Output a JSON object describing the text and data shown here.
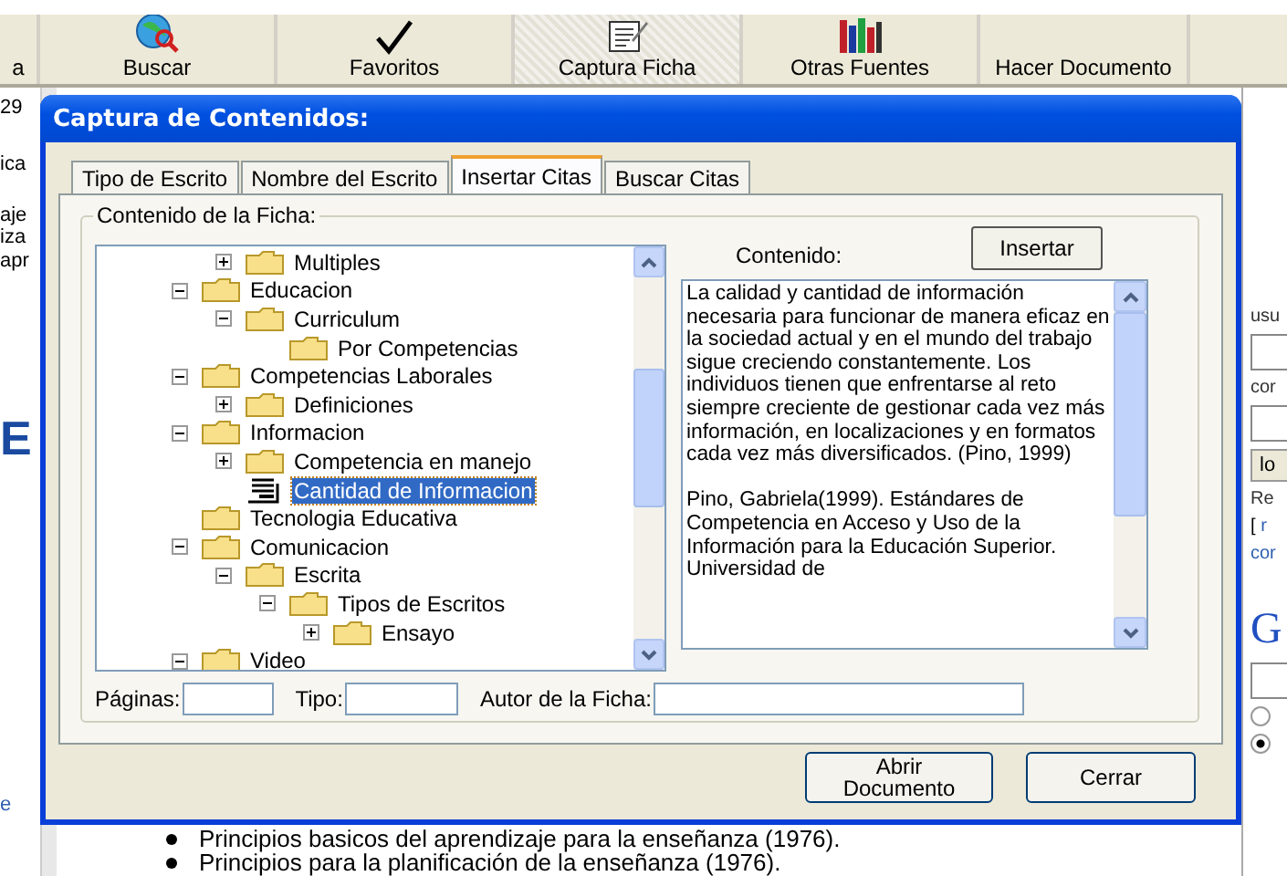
{
  "toolbar": [
    {
      "kind": "plain",
      "label": "a",
      "selected": false
    },
    {
      "kind": "search",
      "label": "Buscar",
      "selected": false
    },
    {
      "kind": "favorites",
      "label": "Favoritos",
      "selected": false
    },
    {
      "kind": "capture",
      "label": "Captura Ficha",
      "selected": true
    },
    {
      "kind": "sources",
      "label": "Otras Fuentes",
      "selected": false
    },
    {
      "kind": "plain",
      "label": "Hacer Documento",
      "selected": false
    }
  ],
  "left_fragments": [
    "29",
    "ica",
    "aje",
    "iza",
    "apr",
    "E",
    "e"
  ],
  "right_panel": [
    {
      "kind": "label",
      "text": "usu"
    },
    {
      "kind": "field"
    },
    {
      "kind": "label",
      "text": "cor"
    },
    {
      "kind": "field"
    },
    {
      "kind": "button",
      "text": "lo"
    },
    {
      "kind": "label",
      "text": "Re"
    },
    {
      "kind": "link",
      "prefix": "[",
      "text": "r"
    },
    {
      "kind": "link",
      "text": "cor"
    },
    {
      "kind": "heading",
      "text": "G"
    },
    {
      "kind": "field"
    },
    {
      "kind": "radio",
      "selected": false
    },
    {
      "kind": "radio",
      "selected": true
    }
  ],
  "bullets": [
    "Principios basicos del aprendizaje para la enseñanza (1976).",
    "Principios para la planificación de la enseñanza (1976)."
  ],
  "dialog": {
    "title": "Captura de Contenidos:",
    "tabs": [
      {
        "label": "Tipo de Escrito",
        "selected": false
      },
      {
        "label": "Nombre del Escrito",
        "selected": false
      },
      {
        "label": "Insertar Citas",
        "selected": true
      },
      {
        "label": "Buscar Citas",
        "selected": false
      }
    ],
    "group_label": "Contenido de la Ficha:",
    "tree": [
      {
        "children": [
          {
            "label": "Multiples",
            "kind": "folder",
            "expanded": false,
            "selected": false
          }
        ]
      },
      {
        "label": "Educacion",
        "kind": "folder",
        "expanded": true,
        "selected": false,
        "children": [
          {
            "label": "Curriculum",
            "kind": "folder",
            "expanded": true,
            "selected": false,
            "children": [
              {
                "label": "Por Competencias",
                "kind": "folder",
                "selected": false
              }
            ]
          }
        ]
      },
      {
        "label": "Competencias Laborales",
        "kind": "folder",
        "expanded": true,
        "selected": false,
        "children": [
          {
            "label": "Definiciones",
            "kind": "folder",
            "expanded": false,
            "selected": false
          }
        ]
      },
      {
        "label": "Informacion",
        "kind": "folder",
        "expanded": true,
        "selected": false,
        "children": [
          {
            "label": "Competencia en manejo",
            "kind": "folder",
            "expanded": false,
            "selected": false
          },
          {
            "label": "Cantidad de Informacion",
            "kind": "document",
            "selected": true
          }
        ]
      },
      {
        "label": "Tecnologia Educativa",
        "kind": "folder",
        "selected": false
      },
      {
        "label": "Comunicacion",
        "kind": "folder",
        "expanded": true,
        "selected": false,
        "children": [
          {
            "label": "Escrita",
            "kind": "folder",
            "expanded": true,
            "selected": false,
            "children": [
              {
                "label": "Tipos de Escritos",
                "kind": "folder",
                "expanded": true,
                "selected": false,
                "children": [
                  {
                    "label": "Ensayo",
                    "kind": "folder",
                    "expanded": false,
                    "selected": false
                  }
                ]
              }
            ]
          }
        ]
      },
      {
        "label": "Video",
        "kind": "folder",
        "expanded": true,
        "selected": false
      }
    ],
    "content_label": "Contenido:",
    "insert_button": "Insertar",
    "content_text": [
      "La calidad y cantidad de información necesaria para funcionar de manera eficaz en la sociedad actual y en el mundo del trabajo sigue creciendo constantemente. Los individuos tienen que enfrentarse al reto siempre creciente de gestionar cada vez más información, en localizaciones y en formatos cada vez más diversificados. (Pino, 1999)",
      "Pino, Gabriela(1999). Estándares de Competencia en Acceso y Uso de la Información para la Educación Superior. Universidad de"
    ],
    "fields": [
      {
        "label": "Páginas:"
      },
      {
        "label": "Tipo:"
      },
      {
        "label": "Autor de la Ficha:"
      }
    ],
    "buttons": [
      "Abrir Documento",
      "Cerrar"
    ]
  }
}
